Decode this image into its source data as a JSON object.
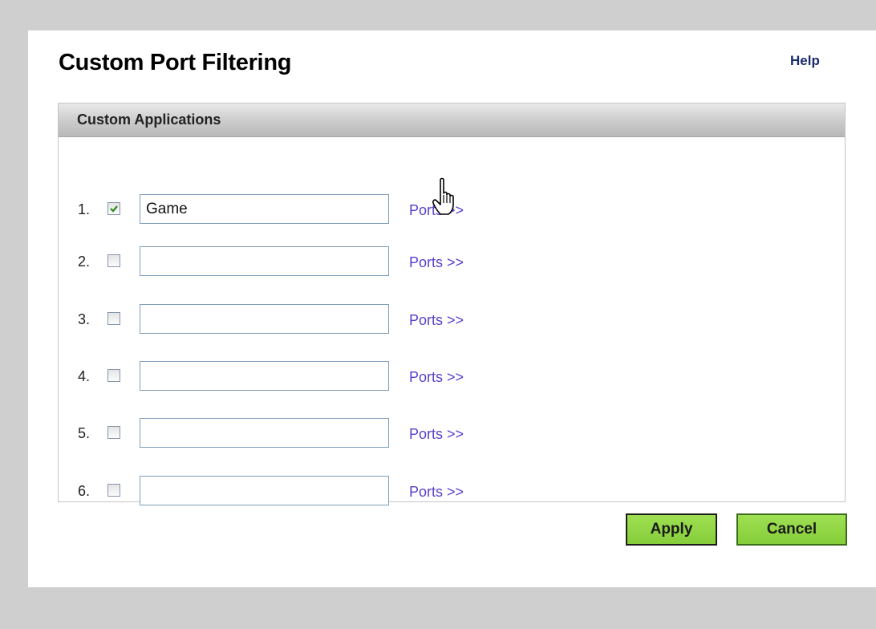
{
  "page": {
    "title": "Custom Port Filtering",
    "help_label": "Help"
  },
  "section": {
    "title": "Custom Applications",
    "rows": [
      {
        "number": "1.",
        "checked": true,
        "value": "Game",
        "ports_label": "Ports >>"
      },
      {
        "number": "2.",
        "checked": false,
        "value": "",
        "ports_label": "Ports >>"
      },
      {
        "number": "3.",
        "checked": false,
        "value": "",
        "ports_label": "Ports >>"
      },
      {
        "number": "4.",
        "checked": false,
        "value": "",
        "ports_label": "Ports >>"
      },
      {
        "number": "5.",
        "checked": false,
        "value": "",
        "ports_label": "Ports >>"
      },
      {
        "number": "6.",
        "checked": false,
        "value": "",
        "ports_label": "Ports >>"
      }
    ]
  },
  "actions": {
    "apply_label": "Apply",
    "cancel_label": "Cancel"
  },
  "colors": {
    "background": "#cfcfcf",
    "link": "#5a3fc9",
    "button_green": "#8fd444",
    "check_green": "#2a8a1c"
  },
  "icons": {
    "cursor": "hand-pointer-icon",
    "check": "checkmark-icon"
  }
}
